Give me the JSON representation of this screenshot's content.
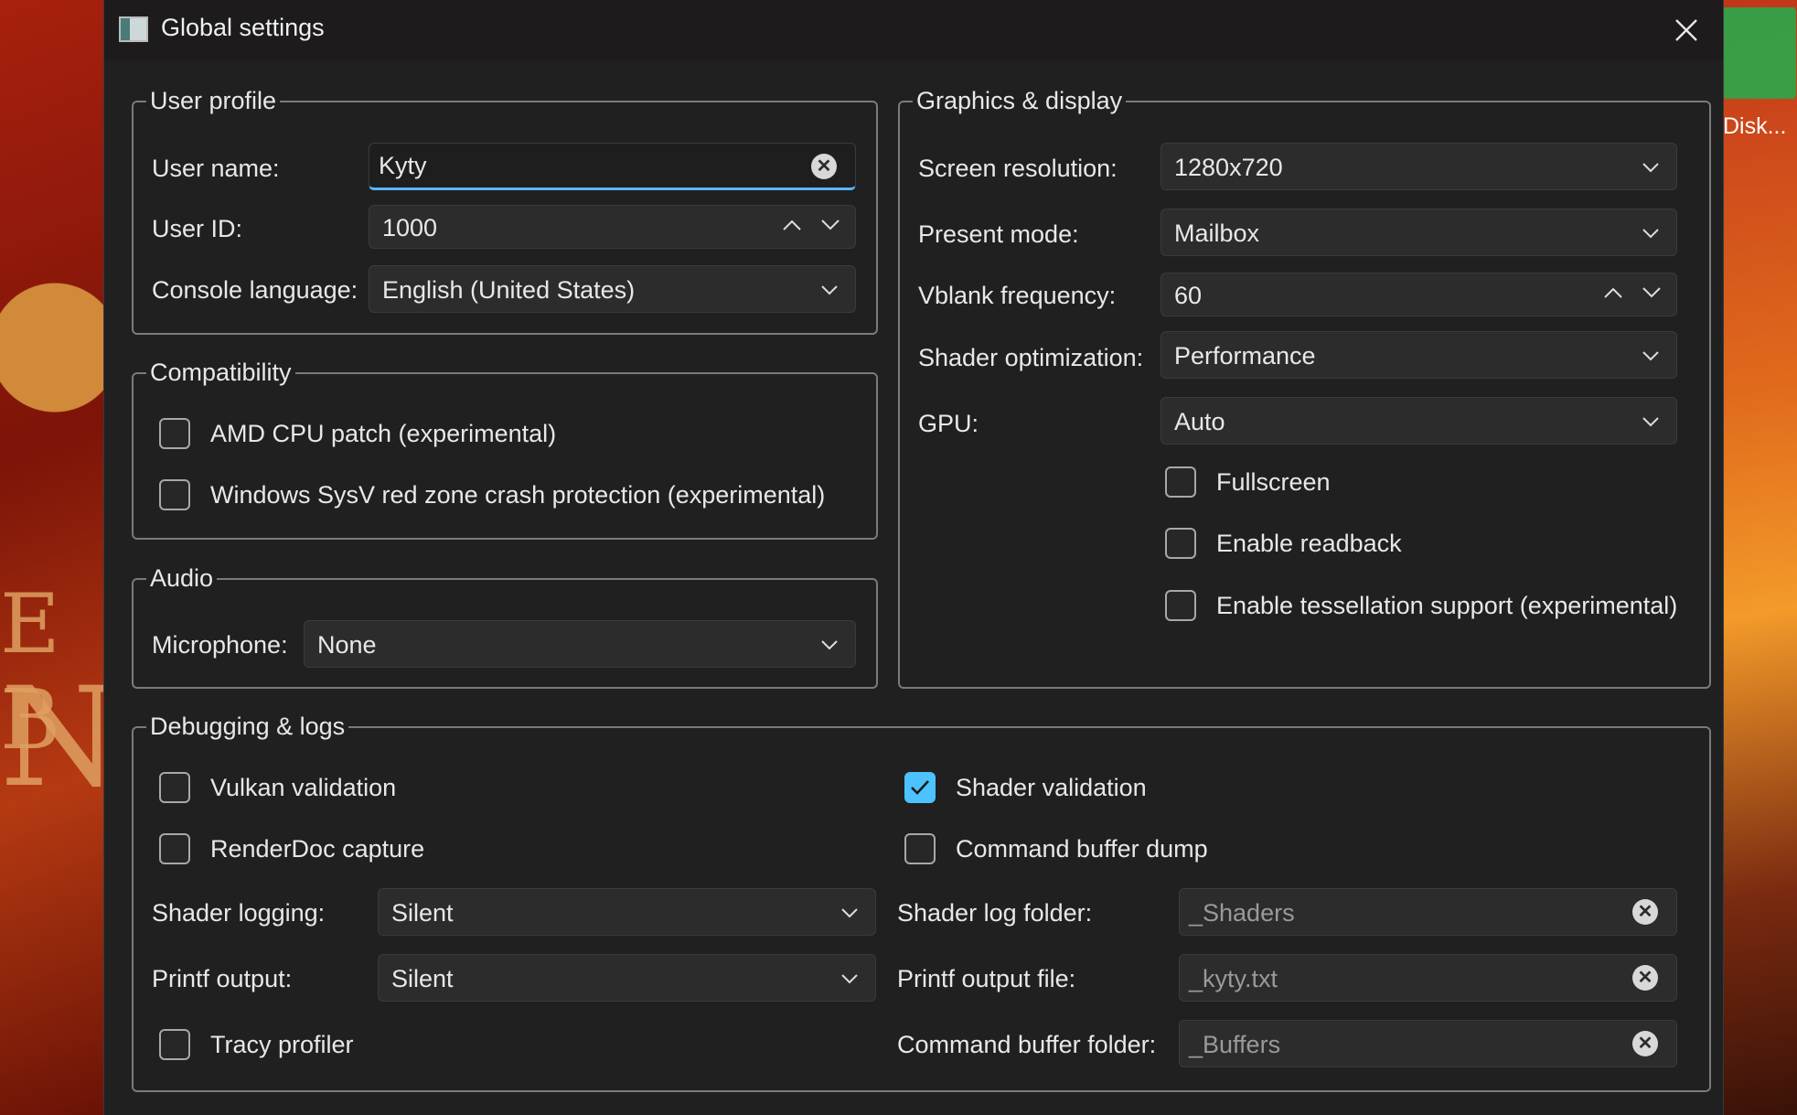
{
  "window": {
    "title": "Global settings",
    "close_icon": "close-icon"
  },
  "desktop": {
    "icon_label": "Disk...",
    "art_letters_left": [
      "E B",
      "N"
    ]
  },
  "user_profile": {
    "title": "User profile",
    "user_name_label": "User name:",
    "user_name_value": "Kyty",
    "user_id_label": "User ID:",
    "user_id_value": "1000",
    "console_language_label": "Console language:",
    "console_language_value": "English (United States)"
  },
  "compatibility": {
    "title": "Compatibility",
    "amd_cpu_patch": {
      "label": "AMD CPU patch (experimental)",
      "checked": false
    },
    "sysv_red_zone": {
      "label": "Windows SysV red zone crash protection (experimental)",
      "checked": false
    }
  },
  "audio": {
    "title": "Audio",
    "microphone_label": "Microphone:",
    "microphone_value": "None"
  },
  "graphics": {
    "title": "Graphics & display",
    "screen_resolution_label": "Screen resolution:",
    "screen_resolution_value": "1280x720",
    "present_mode_label": "Present mode:",
    "present_mode_value": "Mailbox",
    "vblank_label": "Vblank frequency:",
    "vblank_value": "60",
    "shader_opt_label": "Shader optimization:",
    "shader_opt_value": "Performance",
    "gpu_label": "GPU:",
    "gpu_value": "Auto",
    "fullscreen": {
      "label": "Fullscreen",
      "checked": false
    },
    "readback": {
      "label": "Enable readback",
      "checked": false
    },
    "tessellation": {
      "label": "Enable tessellation support (experimental)",
      "checked": false
    }
  },
  "debugging": {
    "title": "Debugging & logs",
    "vulkan_validation": {
      "label": "Vulkan validation",
      "checked": false
    },
    "shader_validation": {
      "label": "Shader validation",
      "checked": true
    },
    "renderdoc_capture": {
      "label": "RenderDoc capture",
      "checked": false
    },
    "command_buffer_dump": {
      "label": "Command buffer dump",
      "checked": false
    },
    "shader_logging_label": "Shader logging:",
    "shader_logging_value": "Silent",
    "printf_output_label": "Printf output:",
    "printf_output_value": "Silent",
    "tracy_profiler": {
      "label": "Tracy profiler",
      "checked": false
    },
    "shader_log_folder_label": "Shader log folder:",
    "shader_log_folder_placeholder": "_Shaders",
    "printf_output_file_label": "Printf output file:",
    "printf_output_file_placeholder": "_kyty.txt",
    "command_buffer_folder_label": "Command buffer folder:",
    "command_buffer_folder_placeholder": "_Buffers"
  },
  "colors": {
    "accent": "#4cc2ff",
    "dialog_bg": "#202020",
    "control_bg": "#2c2c2c"
  }
}
